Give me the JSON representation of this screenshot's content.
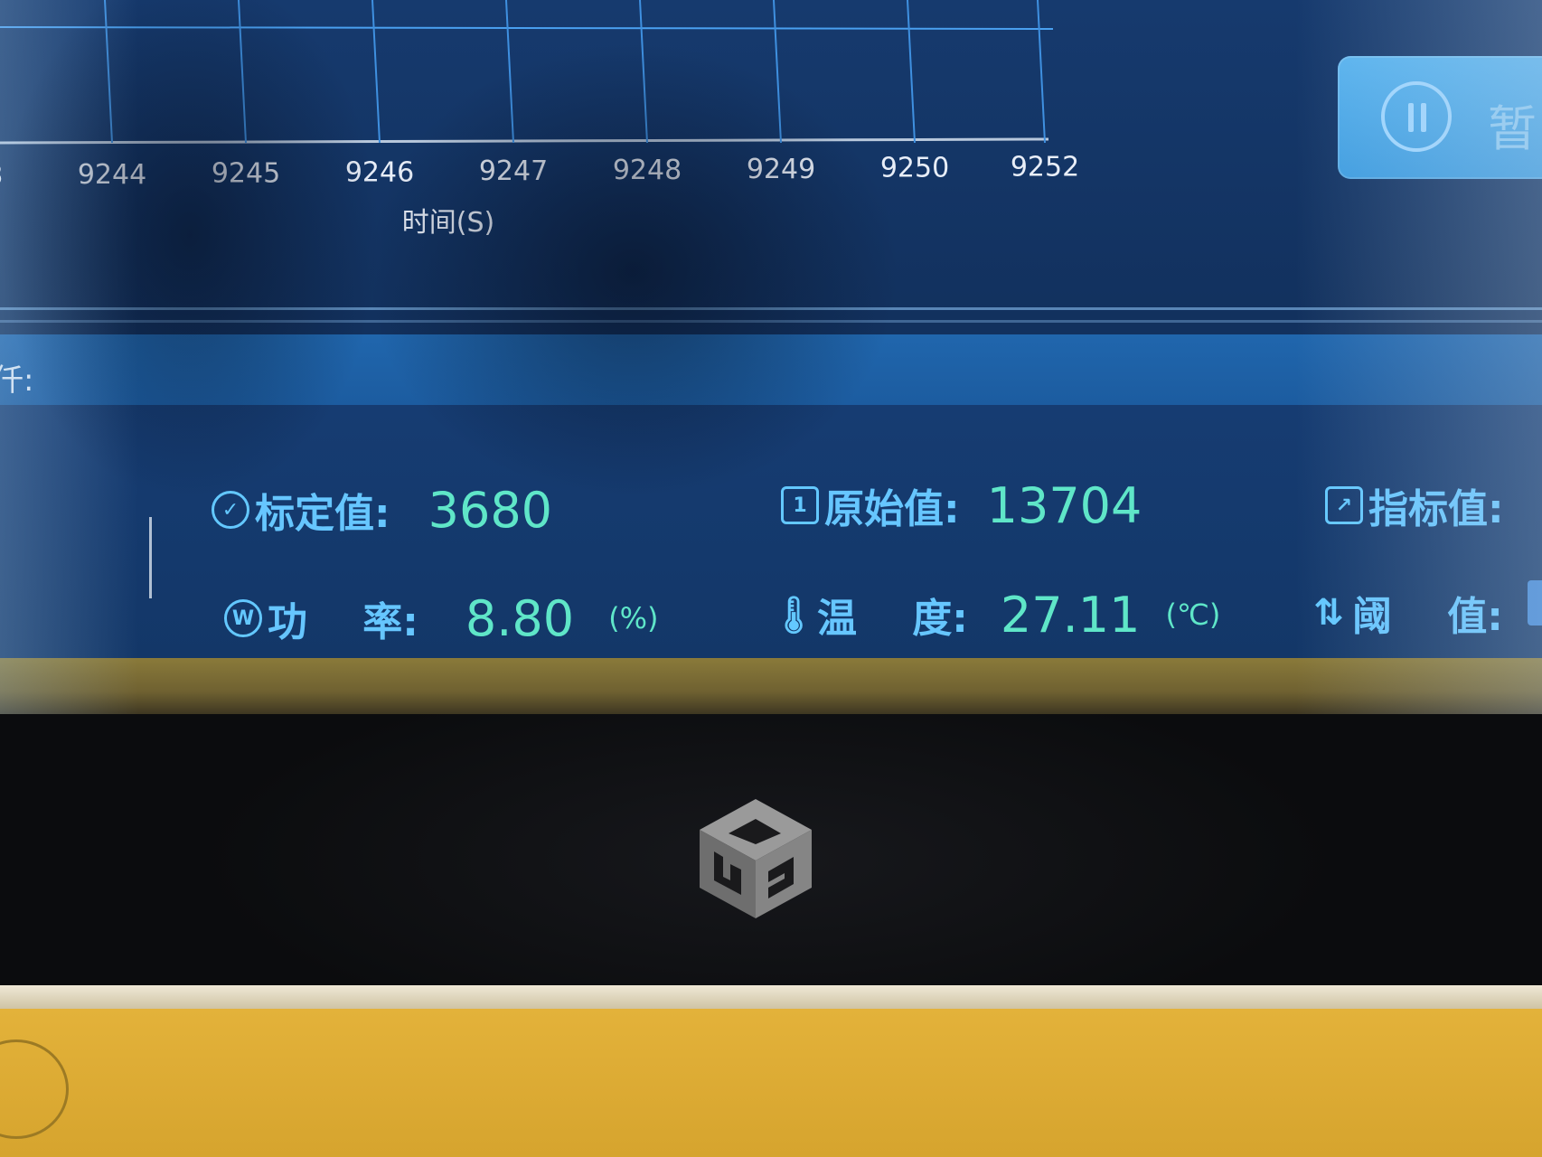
{
  "chart": {
    "x_ticks": [
      "3",
      "9244",
      "9245",
      "9246",
      "9247",
      "9248",
      "9249",
      "9250",
      "9252"
    ],
    "x_title": "时间(S)"
  },
  "toolbar": {
    "pause_label": "暂"
  },
  "field_band": {
    "clipped_label": "仟:"
  },
  "readings": {
    "calibrated": {
      "label": "标定值:",
      "value": "3680"
    },
    "raw": {
      "label": "原始值:",
      "value": "13704"
    },
    "indicator": {
      "label": "指标值:"
    },
    "power": {
      "label": "功    率:",
      "value": "8.80",
      "unit": "(%)"
    },
    "temperature": {
      "label": "温    度:",
      "value": "27.11",
      "unit": "(℃)"
    },
    "threshold": {
      "label": "阈    值:"
    }
  },
  "icons": {
    "calibrated": "gauge-check-icon",
    "raw": "number-one-box-icon",
    "indicator": "chart-box-icon",
    "power": "power-w-icon",
    "temperature": "thermometer-icon",
    "threshold": "threshold-icon"
  },
  "colors": {
    "screen_bg": "#133768",
    "label_blue": "#66c6ff",
    "value_teal": "#5fe6c8",
    "casing_yellow": "#e3b23a",
    "pause_button": "#4aa8e8"
  }
}
